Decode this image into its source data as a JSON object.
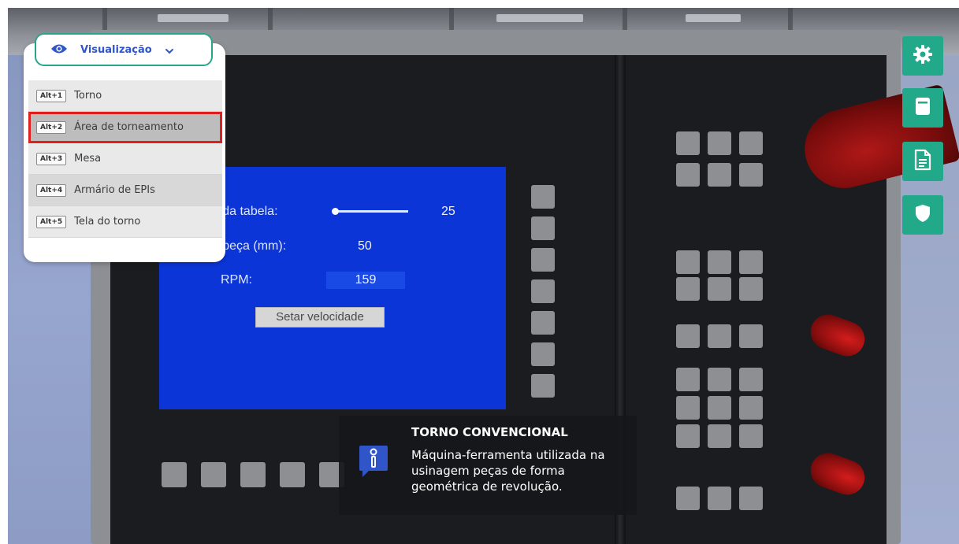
{
  "view_menu": {
    "dropdown_label": "Visualização",
    "items": [
      {
        "shortcut": "Alt+1",
        "label": "Torno"
      },
      {
        "shortcut": "Alt+2",
        "label": "Área de torneamento"
      },
      {
        "shortcut": "Alt+3",
        "label": "Mesa"
      },
      {
        "shortcut": "Alt+4",
        "label": "Armário de EPIs"
      },
      {
        "shortcut": "Alt+5",
        "label": "Tela do torno"
      }
    ]
  },
  "lathe_screen": {
    "table_label": "de da tabela:",
    "table_value": "25",
    "piece_label": "da peça (mm):",
    "piece_value": "50",
    "rpm_label": "RPM:",
    "rpm_value": "159",
    "set_speed_button": "Setar velocidade"
  },
  "info": {
    "title": "TORNO CONVENCIONAL",
    "text": "Máquina-ferramenta utilizada na usinagem peças de forma geométrica de revolução."
  },
  "toolbar": {
    "icons": [
      "gear-icon",
      "document-icon",
      "file-text-icon",
      "shield-icon"
    ],
    "accent_color": "#21a98a"
  },
  "colors": {
    "selection_outline": "#e01e1e",
    "dropdown_border": "#2aa48b",
    "lathe_screen_bg": "#0c35d8"
  }
}
